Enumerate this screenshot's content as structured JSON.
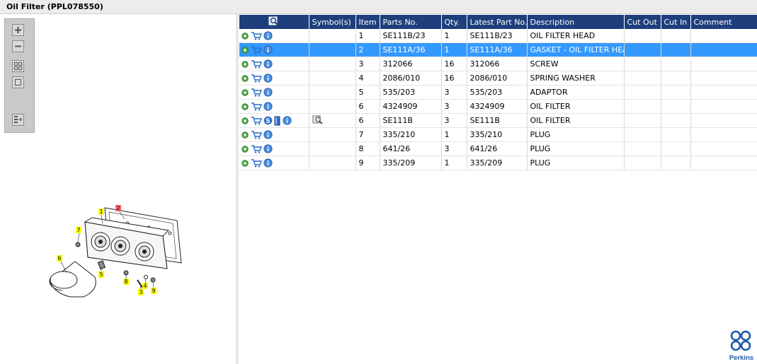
{
  "window": {
    "title": "Oil Filter (PPL078550)"
  },
  "toolbar": {
    "buttons": [
      {
        "icon": "zoom-in-icon"
      },
      {
        "icon": "zoom-out-icon"
      },
      {
        "icon": "fit-all-icon"
      },
      {
        "icon": "fit-page-icon"
      },
      {
        "icon": "panel-toggle-icon"
      }
    ]
  },
  "diagram": {
    "callouts": [
      "1",
      "2",
      "7",
      "6",
      "5",
      "8",
      "4",
      "3",
      "9"
    ],
    "highlight_color": "#ffff00",
    "selected_color": "#ff6666"
  },
  "table": {
    "columns": [
      "Symbol(s)",
      "Item",
      "Parts No.",
      "Qty.",
      "Latest Part No.",
      "Description",
      "Cut Out",
      "Cut In",
      "Comment"
    ],
    "rows": [
      {
        "item": "1",
        "part": "SE111B/23",
        "qty": "1",
        "latest": "SE111B/23",
        "desc": "OIL FILTER HEAD"
      },
      {
        "item": "2",
        "part": "SE111A/36",
        "qty": "1",
        "latest": "SE111A/36",
        "desc": "GASKET - OIL FILTER HEAD",
        "selected": true
      },
      {
        "item": "3",
        "part": "312066",
        "qty": "16",
        "latest": "312066",
        "desc": "SCREW"
      },
      {
        "item": "4",
        "part": "2086/010",
        "qty": "16",
        "latest": "2086/010",
        "desc": "SPRING WASHER"
      },
      {
        "item": "5",
        "part": "535/203",
        "qty": "3",
        "latest": "535/203",
        "desc": "ADAPTOR"
      },
      {
        "item": "6",
        "part": "4324909",
        "qty": "3",
        "latest": "4324909",
        "desc": "OIL FILTER"
      },
      {
        "item": "6",
        "part": "SE111B",
        "qty": "3",
        "latest": "SE111B",
        "desc": "OIL FILTER",
        "extra": true
      },
      {
        "item": "7",
        "part": "335/210",
        "qty": "1",
        "latest": "335/210",
        "desc": "PLUG"
      },
      {
        "item": "8",
        "part": "641/26",
        "qty": "3",
        "latest": "641/26",
        "desc": "PLUG"
      },
      {
        "item": "9",
        "part": "335/209",
        "qty": "1",
        "latest": "335/209",
        "desc": "PLUG"
      }
    ]
  },
  "brand": {
    "name": "Perkins",
    "color": "#1e5aa8"
  },
  "colors": {
    "header_bg": "#1e3f7c",
    "selected_row": "#3399ff",
    "gear": "#4caf50",
    "cart": "#2a6fc9",
    "info": "#4a8fe0"
  }
}
